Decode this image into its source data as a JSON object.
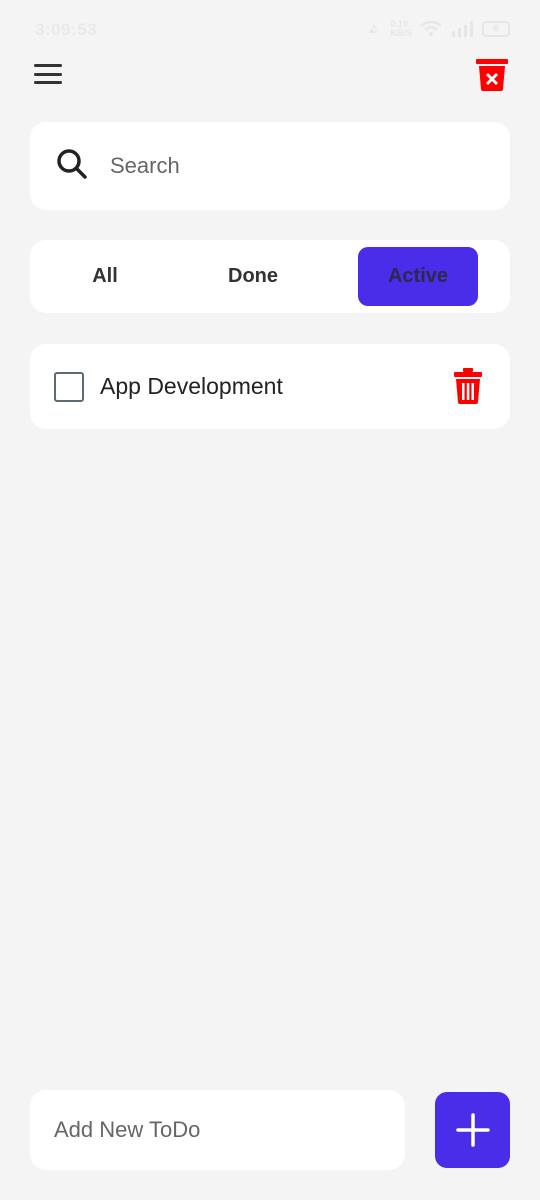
{
  "status_bar": {
    "time": "3:09:53",
    "network_speed": "0.10",
    "network_unit": "KB/S",
    "battery": "8"
  },
  "header": {
    "menu_icon": "hamburger-menu-icon",
    "clear_icon": "delete-all-icon",
    "accent_color": "#ff0000"
  },
  "search": {
    "placeholder": "Search",
    "icon": "search-icon"
  },
  "filters": {
    "tabs": [
      {
        "label": "All"
      },
      {
        "label": "Done"
      },
      {
        "label": "Active"
      }
    ],
    "selected": "Active",
    "selected_color": "#4a2de8"
  },
  "todos": [
    {
      "title": "App Development",
      "done": false,
      "delete_icon": "trash-icon"
    }
  ],
  "add_todo": {
    "placeholder": "Add New ToDo",
    "button_icon": "plus-icon",
    "button_color": "#4a2de8"
  }
}
